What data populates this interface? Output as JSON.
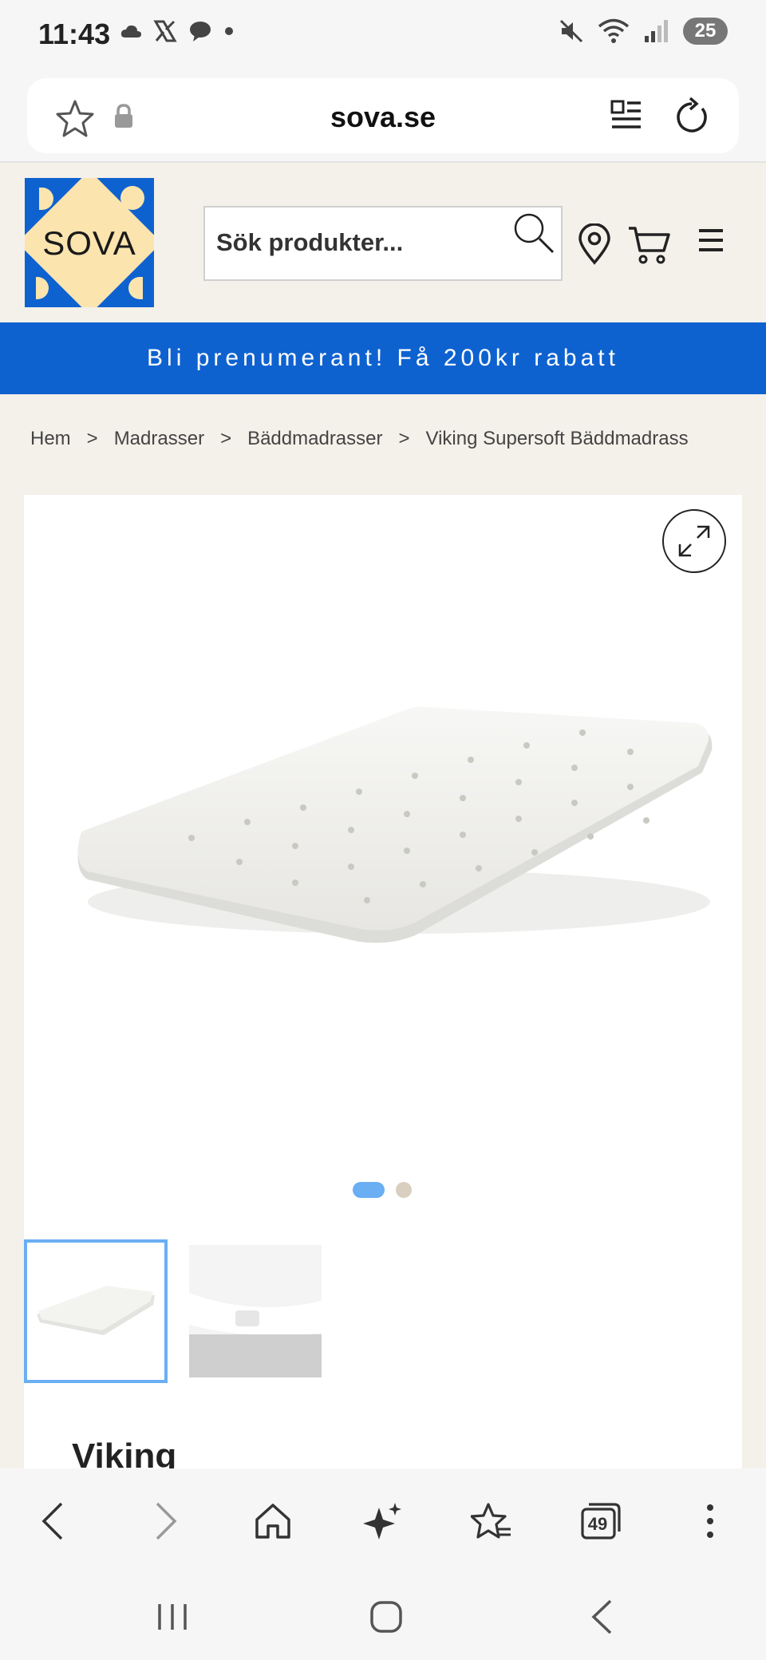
{
  "status_bar": {
    "time": "11:43",
    "battery": "25"
  },
  "browser": {
    "url": "sova.se",
    "tabs_count": "49"
  },
  "site": {
    "logo_text": "SOVA",
    "search_placeholder": "Sök produkter...",
    "promo_text": "Bli prenumerant! Få 200kr rabatt"
  },
  "breadcrumb": [
    {
      "label": "Hem"
    },
    {
      "label": "Madrasser"
    },
    {
      "label": "Bäddmadrasser"
    },
    {
      "label": "Viking Supersoft Bäddmadrass"
    }
  ],
  "product": {
    "title_partial": "Viking",
    "gallery_images": 2,
    "active_image": 1
  },
  "colors": {
    "brand_blue": "#0e62d0",
    "logo_yellow": "#fbe4ae",
    "accent_light_blue": "#6aaef4",
    "page_bg": "#f4f1ea"
  }
}
